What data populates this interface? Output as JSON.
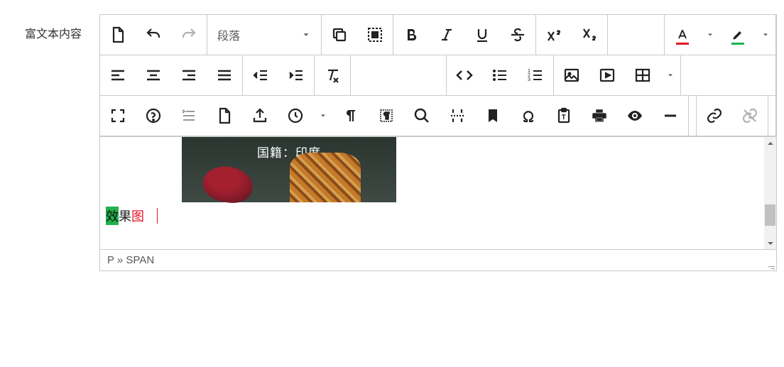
{
  "label": "富文本内容",
  "format_dropdown": "段落",
  "content": {
    "image_caption": "国籍：印度",
    "text_hl": "效",
    "text_mid": "果",
    "text_end": "图"
  },
  "breadcrumb": "P » SPAN"
}
